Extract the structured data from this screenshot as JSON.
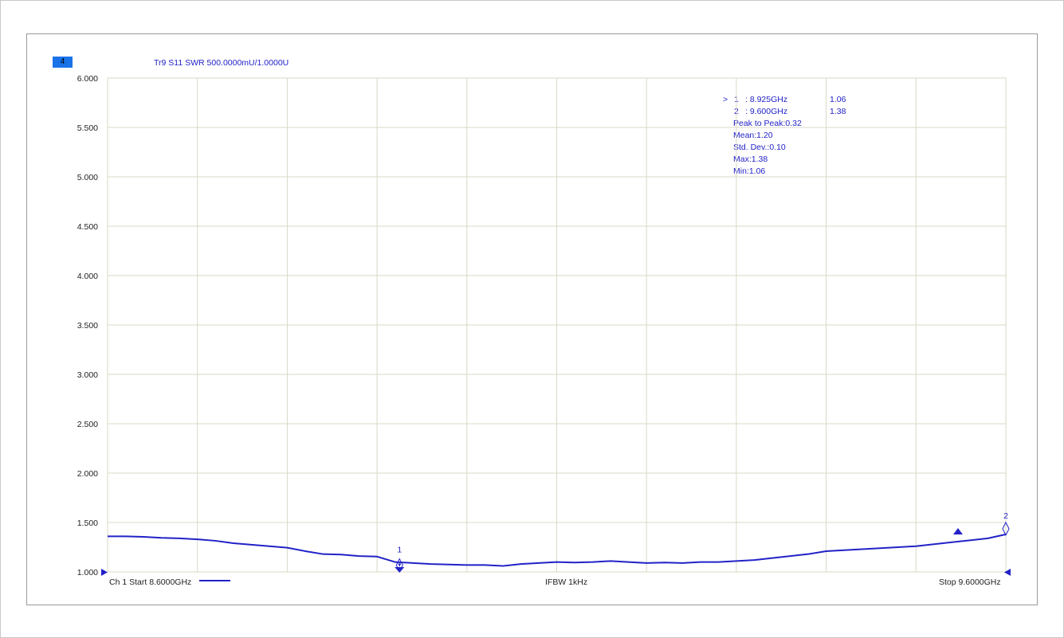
{
  "window": {
    "channel_badge": "4",
    "trace_label": "Tr9 S11 SWR 500.0000mU/1.0000U"
  },
  "markers": {
    "rows": [
      {
        "active": ">",
        "num": "1",
        "freq": ": 8.925GHz",
        "value": "1.06"
      },
      {
        "active": "",
        "num": "2",
        "freq": ": 9.600GHz",
        "value": "1.38"
      }
    ],
    "stats": [
      "Peak to Peak:0.32",
      "Mean:1.20",
      "Std. Dev.:0.10",
      "Max:1.38",
      "Min:1.06"
    ],
    "labels": [
      "1",
      "2"
    ]
  },
  "footer": {
    "start": "Ch 1 Start 8.6000GHz",
    "ifbw": "IFBW 1kHz",
    "stop": "Stop 9.6000GHz"
  },
  "colors": {
    "trace": "#2222c8",
    "grid": "#d9d9c6",
    "badge": "#1a73e8"
  },
  "chart_data": {
    "type": "line",
    "title": "",
    "xlabel": "",
    "ylabel": "",
    "xlim": [
      8.6,
      9.6
    ],
    "ylim": [
      1.0,
      6.0
    ],
    "grid": true,
    "yticks": [
      "6.000",
      "5.500",
      "5.000",
      "4.500",
      "4.000",
      "3.500",
      "3.000",
      "2.500",
      "2.000",
      "1.500",
      "1.000"
    ],
    "series": [
      {
        "x": [
          8.6,
          8.62,
          8.64,
          8.66,
          8.68,
          8.7,
          8.72,
          8.74,
          8.76,
          8.78,
          8.8,
          8.82,
          8.84,
          8.86,
          8.88,
          8.9,
          8.92,
          8.94,
          8.96,
          8.98,
          9.0,
          9.02,
          9.04,
          9.06,
          9.08,
          9.1,
          9.12,
          9.14,
          9.16,
          9.18,
          9.2,
          9.22,
          9.24,
          9.26,
          9.28,
          9.3,
          9.32,
          9.34,
          9.36,
          9.38,
          9.4,
          9.42,
          9.44,
          9.46,
          9.48,
          9.5,
          9.52,
          9.54,
          9.56,
          9.58,
          9.6
        ],
        "values": [
          1.36,
          1.36,
          1.355,
          1.345,
          1.34,
          1.33,
          1.315,
          1.29,
          1.275,
          1.26,
          1.245,
          1.21,
          1.18,
          1.175,
          1.16,
          1.155,
          1.1,
          1.09,
          1.08,
          1.075,
          1.07,
          1.07,
          1.06,
          1.08,
          1.09,
          1.1,
          1.095,
          1.1,
          1.11,
          1.1,
          1.09,
          1.095,
          1.09,
          1.1,
          1.1,
          1.11,
          1.12,
          1.14,
          1.16,
          1.18,
          1.21,
          1.22,
          1.23,
          1.24,
          1.25,
          1.26,
          1.28,
          1.3,
          1.32,
          1.34,
          1.38
        ]
      }
    ]
  }
}
